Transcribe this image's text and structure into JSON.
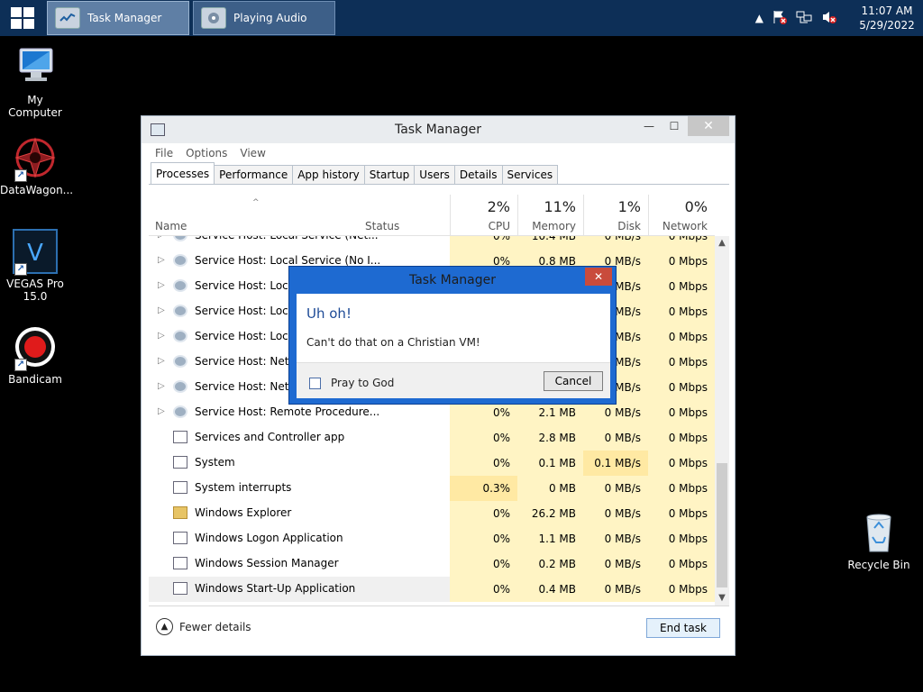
{
  "taskbar": {
    "apps": [
      {
        "label": "Task Manager",
        "icon": "task-manager-icon"
      },
      {
        "label": "Playing Audio",
        "icon": "audio-icon"
      }
    ],
    "clock": {
      "time": "11:07 AM",
      "date": "5/29/2022"
    },
    "tray_icons": [
      "chevron-up-icon",
      "flag-icon",
      "network-icon",
      "volume-muted-icon"
    ]
  },
  "desktop": {
    "icons": [
      {
        "label": "My Computer",
        "icon": "computer-icon"
      },
      {
        "label": "DataWagon...",
        "icon": "datawagon-icon"
      },
      {
        "label": "VEGAS Pro 15.0",
        "icon": "vegas-pro-icon"
      },
      {
        "label": "Bandicam",
        "icon": "bandicam-icon"
      },
      {
        "label": "Recycle Bin",
        "icon": "recycle-bin-icon"
      }
    ]
  },
  "task_manager": {
    "title": "Task Manager",
    "menu": [
      "File",
      "Options",
      "View"
    ],
    "tabs": [
      "Processes",
      "Performance",
      "App history",
      "Startup",
      "Users",
      "Details",
      "Services"
    ],
    "columns": {
      "name": "Name",
      "status": "Status",
      "cpu": {
        "label": "CPU",
        "percent": "2%"
      },
      "memory": {
        "label": "Memory",
        "percent": "11%"
      },
      "disk": {
        "label": "Disk",
        "percent": "1%"
      },
      "network": {
        "label": "Network",
        "percent": "0%"
      }
    },
    "rows": [
      {
        "name": "Service Host: Local Service (Net...",
        "expandable": true,
        "icon": "service-icon",
        "cpu": "0%",
        "memory": "10.4 MB",
        "disk": "0 MB/s",
        "network": "0 Mbps"
      },
      {
        "name": "Service Host: Local Service (No I...",
        "expandable": true,
        "icon": "service-icon",
        "cpu": "0%",
        "memory": "0.8 MB",
        "disk": "0 MB/s",
        "network": "0 Mbps"
      },
      {
        "name": "Service Host: Local S",
        "expandable": true,
        "icon": "service-icon",
        "cpu": "",
        "memory": "",
        "disk": "MB/s",
        "network": "0 Mbps"
      },
      {
        "name": "Service Host: Local S",
        "expandable": true,
        "icon": "service-icon",
        "cpu": "",
        "memory": "",
        "disk": "MB/s",
        "network": "0 Mbps"
      },
      {
        "name": "Service Host: Local S",
        "expandable": true,
        "icon": "service-icon",
        "cpu": "",
        "memory": "",
        "disk": "MB/s",
        "network": "0 Mbps"
      },
      {
        "name": "Service Host: Netwo",
        "expandable": true,
        "icon": "service-icon",
        "cpu": "",
        "memory": "",
        "disk": "MB/s",
        "network": "0 Mbps"
      },
      {
        "name": "Service Host: Netwo",
        "expandable": true,
        "icon": "service-icon",
        "cpu": "",
        "memory": "",
        "disk": "MB/s",
        "network": "0 Mbps"
      },
      {
        "name": "Service Host: Remote Procedure...",
        "expandable": true,
        "icon": "service-icon",
        "cpu": "0%",
        "memory": "2.1 MB",
        "disk": "0 MB/s",
        "network": "0 Mbps"
      },
      {
        "name": "Services and Controller app",
        "expandable": false,
        "icon": "app-icon",
        "cpu": "0%",
        "memory": "2.8 MB",
        "disk": "0 MB/s",
        "network": "0 Mbps"
      },
      {
        "name": "System",
        "expandable": false,
        "icon": "app-icon",
        "cpu": "0%",
        "memory": "0.1 MB",
        "disk": "0.1 MB/s",
        "network": "0 Mbps"
      },
      {
        "name": "System interrupts",
        "expandable": false,
        "icon": "app-icon",
        "cpu": "0.3%",
        "memory": "0 MB",
        "disk": "0 MB/s",
        "network": "0 Mbps"
      },
      {
        "name": "Windows Explorer",
        "expandable": false,
        "icon": "folder-icon",
        "cpu": "0%",
        "memory": "26.2 MB",
        "disk": "0 MB/s",
        "network": "0 Mbps"
      },
      {
        "name": "Windows Logon Application",
        "expandable": false,
        "icon": "app-icon",
        "cpu": "0%",
        "memory": "1.1 MB",
        "disk": "0 MB/s",
        "network": "0 Mbps"
      },
      {
        "name": "Windows Session Manager",
        "expandable": false,
        "icon": "app-icon",
        "cpu": "0%",
        "memory": "0.2 MB",
        "disk": "0 MB/s",
        "network": "0 Mbps"
      },
      {
        "name": "Windows Start-Up Application",
        "expandable": false,
        "icon": "app-icon",
        "cpu": "0%",
        "memory": "0.4 MB",
        "disk": "0 MB/s",
        "network": "0 Mbps"
      }
    ],
    "footer": {
      "fewer_details": "Fewer details",
      "end_task": "End task"
    }
  },
  "dialog": {
    "title": "Task Manager",
    "heading": "Uh oh!",
    "message": "Can't do that on a Christian VM!",
    "checkbox_label": "Pray to God",
    "checkbox_checked": false,
    "cancel": "Cancel"
  },
  "colors": {
    "taskbar": "#0d2f57",
    "dialog_frame": "#1e6ad1",
    "heat": "#fff4c4",
    "heading": "#1d4a96"
  }
}
